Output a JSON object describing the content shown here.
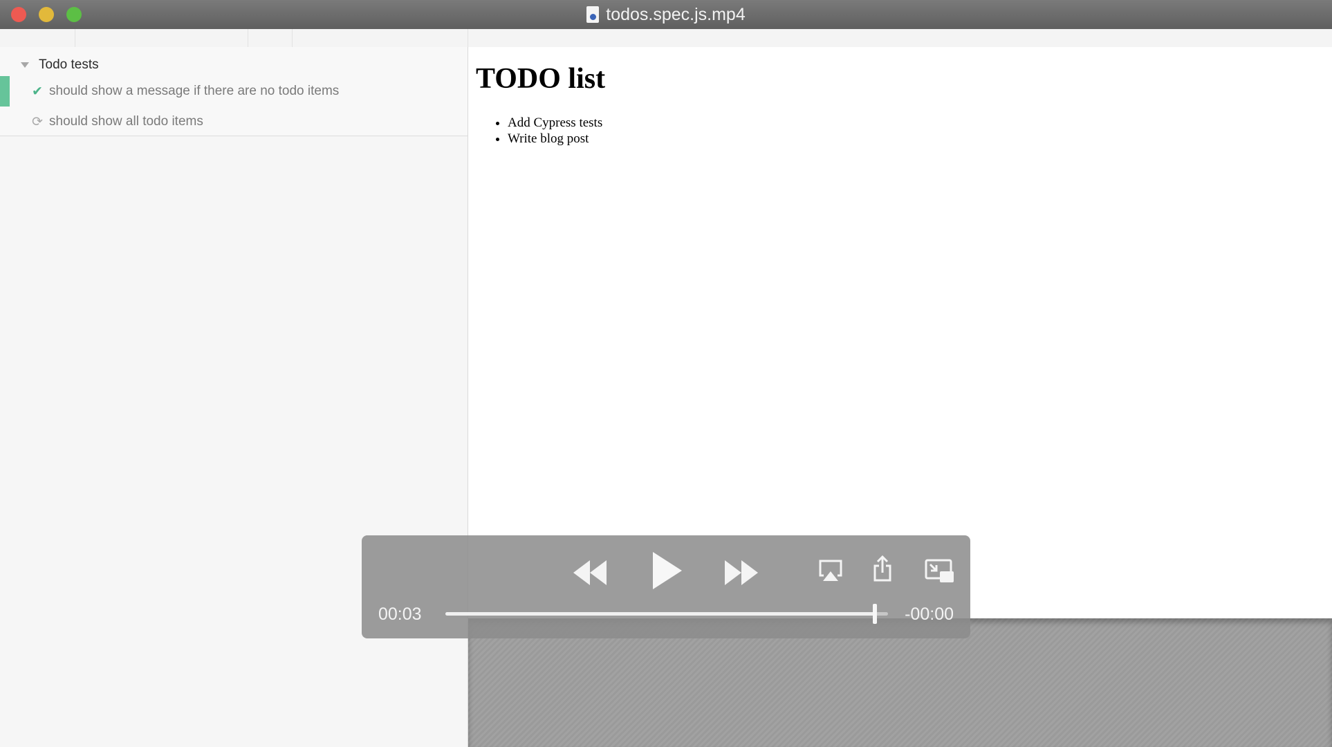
{
  "window": {
    "title": "todos.spec.js.mp4",
    "file_icon": "video-document-icon"
  },
  "test_runner": {
    "suite": {
      "label": "Todo tests",
      "icon": "caret-down-icon"
    },
    "tests": [
      {
        "label": "should show a message if there are no todo items",
        "icon": "check-icon",
        "status": "passed",
        "status_color": "#4cb48a"
      },
      {
        "label": "should show all todo items",
        "icon": "refresh-icon",
        "status": "running",
        "status_color": "#a9a9a9"
      }
    ]
  },
  "app_preview": {
    "heading": "TODO list",
    "items": [
      "Add Cypress tests",
      "Write blog post"
    ]
  },
  "player": {
    "elapsed": "00:03",
    "remaining": "-00:00",
    "progress": 0.97,
    "controls": [
      "rewind-icon",
      "play-icon",
      "fast-forward-icon",
      "airplay-icon",
      "share-icon",
      "picture-in-picture-icon"
    ]
  }
}
